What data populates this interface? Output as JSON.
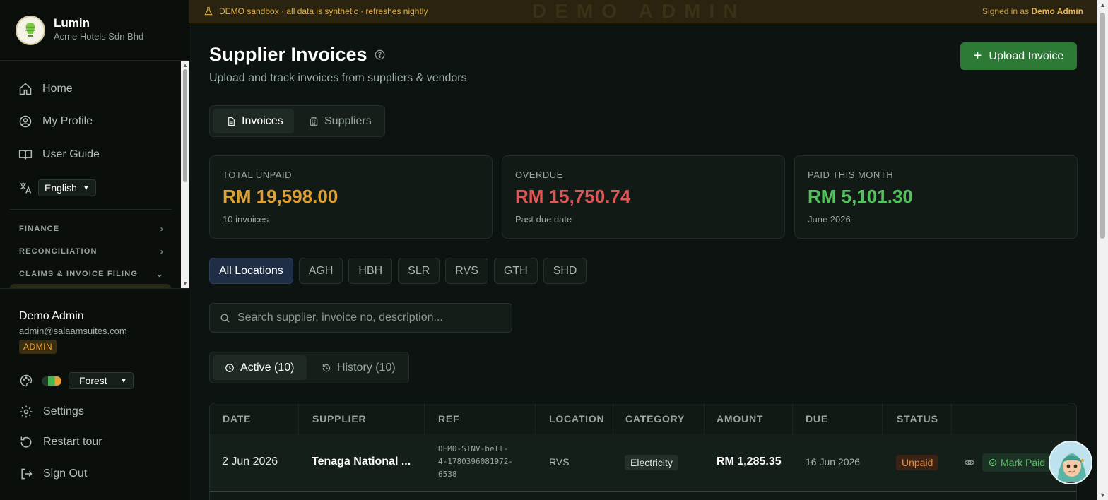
{
  "brand": {
    "name": "Lumin",
    "company": "Acme Hotels Sdn Bhd"
  },
  "nav": {
    "home": "Home",
    "profile": "My Profile",
    "guide": "User Guide",
    "language": "English",
    "sections": [
      "FINANCE",
      "RECONCILIATION",
      "CLAIMS & INVOICE FILING"
    ]
  },
  "user": {
    "name": "Demo Admin",
    "email": "admin@salaamsuites.com",
    "role": "ADMIN",
    "theme": "Forest",
    "settings": "Settings",
    "restart_tour": "Restart tour",
    "sign_out": "Sign Out"
  },
  "banner": {
    "message": "DEMO sandbox · all data is synthetic · refreshes nightly",
    "watermark": "DEMO ADMIN",
    "signed_in_prefix": "Signed in as",
    "signed_in_user": "Demo Admin"
  },
  "page": {
    "title": "Supplier Invoices",
    "subtitle": "Upload and track invoices from suppliers & vendors",
    "upload_label": "Upload Invoice",
    "tabs": [
      "Invoices",
      "Suppliers"
    ]
  },
  "stats": [
    {
      "label": "TOTAL UNPAID",
      "value": "RM 19,598.00",
      "foot": "10 invoices",
      "color": "#e0a030"
    },
    {
      "label": "OVERDUE",
      "value": "RM 15,750.74",
      "foot": "Past due date",
      "color": "#e05555"
    },
    {
      "label": "PAID THIS MONTH",
      "value": "RM 5,101.30",
      "foot": "June 2026",
      "color": "#52c35c"
    }
  ],
  "locations": [
    "All Locations",
    "AGH",
    "HBH",
    "SLR",
    "RVS",
    "GTH",
    "SHD"
  ],
  "search": {
    "placeholder": "Search supplier, invoice no, description..."
  },
  "status_tabs": [
    "Active (10)",
    "History (10)"
  ],
  "table": {
    "headers": [
      "DATE",
      "SUPPLIER",
      "REF",
      "LOCATION",
      "CATEGORY",
      "AMOUNT",
      "DUE",
      "STATUS"
    ],
    "rows": [
      {
        "date": "2 Jun 2026",
        "supplier": "Tenaga National ...",
        "ref_lines": [
          "DEMO-SINV-bell-",
          "4-1780396081972-",
          "6538"
        ],
        "location": "RVS",
        "category": "Electricity",
        "amount": "RM 1,285.35",
        "due": "16 Jun 2026",
        "status": "Unpaid",
        "action": "Mark Paid"
      }
    ]
  }
}
